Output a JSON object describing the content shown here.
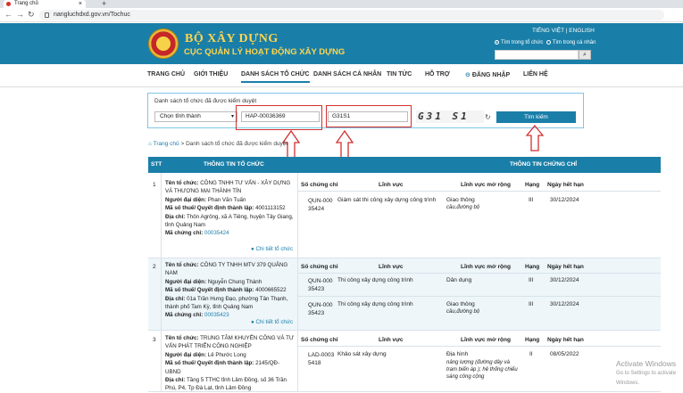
{
  "browser": {
    "tab_title": "Trang chủ",
    "tab_close": "×",
    "new_tab": "+",
    "url": "nangluchdxd.gov.vn/Tochuc"
  },
  "header": {
    "title": "BỘ XÂY DỰNG",
    "subtitle": "CỤC QUẢN LÝ HOẠT ĐỘNG XÂY DỰNG",
    "lang": "TIẾNG VIỆT | ENGLISH",
    "radio_org": "Tìm trong tổ chức",
    "radio_person": "Tìm trong cá nhân"
  },
  "menu": [
    "TRANG CHỦ",
    "GIỚI THIỆU",
    "DANH SÁCH TỔ CHỨC",
    "DANH SÁCH CÁ NHÂN",
    "TIN TỨC",
    "HỖ TRỢ",
    "ĐĂNG NHẬP",
    "LIÊN HỆ"
  ],
  "filter": {
    "title": "Danh sách tổ chức đã được kiểm duyệt",
    "province": "Chọn tỉnh thành",
    "cert_code": "HAP-00036369",
    "captcha_input": "G31S1",
    "captcha_image": "G31 S1",
    "search_button": "Tìm kiếm"
  },
  "breadcrumb": {
    "home": "Trang chủ",
    "sep": ">",
    "current": "Danh sách tổ chức đã được kiểm duyệt"
  },
  "table": {
    "headers": {
      "stt": "STT",
      "org": "THÔNG TIN TỔ CHỨC",
      "cert": "THÔNG TIN CHỨNG CHỈ"
    },
    "subheaders": [
      "Số chứng chỉ",
      "Lĩnh vực",
      "Lĩnh vực mở rộng",
      "Hạng",
      "Ngày hết hạn"
    ],
    "rows": [
      {
        "stt": "1",
        "name_label": "Tên tổ chức:",
        "name": "CÔNG TNHH TƯ VẤN - XÂY DỰNG VÀ THƯƠNG MẠI THÀNH TÍN",
        "rep_label": "Người đại diện:",
        "rep": "Phan Văn Tuấn",
        "tax_label": "Mã số thuế/ Quyết định thành lập:",
        "tax": "4001113152",
        "addr_label": "Địa chỉ:",
        "addr": "Thôn Agrông, xã A Tiêng, huyện Tây Giang, tỉnh Quảng Nam",
        "code_label": "Mã chứng chỉ:",
        "code": "00035424",
        "detail": "Chi tiết tổ chức",
        "certs": [
          {
            "no": "QUN-00035424",
            "field": "Giám sát thi công xây dựng công trình",
            "ext": "Giao thông",
            "ext2": "cầu,đường bộ",
            "rank": "III",
            "exp": "30/12/2024"
          }
        ]
      },
      {
        "stt": "2",
        "name_label": "Tên tổ chức:",
        "name": "CÔNG TY TNHH MTV 379 QUẢNG NAM",
        "rep_label": "Người đại diện:",
        "rep": "Nguyễn Chung Thành",
        "tax_label": "Mã số thuế/ Quyết định thành lập:",
        "tax": "4000665522",
        "addr_label": "Địa chỉ:",
        "addr": "01a Trần Hưng Đạo, phường Tân Thạnh, thành phố Tam Kỳ, tỉnh Quảng Nam",
        "code_label": "Mã chứng chỉ:",
        "code": "00035423",
        "detail": "Chi tiết tổ chức",
        "certs": [
          {
            "no": "QUN-00035423",
            "field": "Thi công xây dựng công trình",
            "ext": "Dân dụng",
            "ext2": "",
            "rank": "III",
            "exp": "30/12/2024"
          },
          {
            "no": "QUN-00035423",
            "field": "Thi công xây dựng công trình",
            "ext": "Giao thông",
            "ext2": "cầu,đường bộ",
            "rank": "III",
            "exp": "30/12/2024"
          }
        ]
      },
      {
        "stt": "3",
        "name_label": "Tên tổ chức:",
        "name": "TRUNG TÂM KHUYẾN CÔNG VÀ TƯ VẤN PHÁT TRIỂN CÔNG NGHIỆP",
        "rep_label": "Người đại diện:",
        "rep": "Lê Phước Long",
        "tax_label": "Mã số thuế/ Quyết định thành lập:",
        "tax": "2145/QĐ-UBND",
        "addr_label": "Địa chỉ:",
        "addr": "Tầng 5 TTHC tỉnh Lâm Đồng, số 36 Trần Phú, P4, Tp Đà Lạt, tỉnh Lâm Đồng",
        "certs": [
          {
            "no": "LAD-00035418",
            "field": "Khảo sát xây dựng",
            "ext": "Địa hình",
            "ext2": "nâng lượng (đường dây và trạm biến áp ); hệ thống chiếu sáng công cộng",
            "rank": "II",
            "exp": "08/05/2022"
          }
        ]
      }
    ]
  },
  "watermark": {
    "line1": "Activate Windows",
    "line2": "Go to Settings to activate Windows."
  },
  "colors": {
    "primary": "#1a7fa8",
    "gold": "#ffd54f",
    "annotation": "#d32f2f"
  }
}
